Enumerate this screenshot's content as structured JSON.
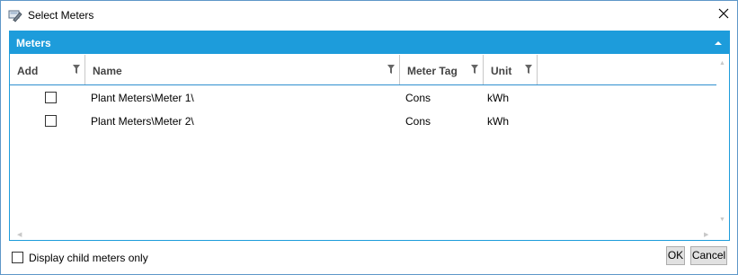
{
  "window": {
    "title": "Select Meters",
    "icon": "meter-select-icon",
    "close_icon": "close-icon"
  },
  "panel": {
    "title": "Meters",
    "collapse_icon": "chevron-up-icon",
    "header_color": "#1d9cdb"
  },
  "grid": {
    "columns": [
      {
        "label": "Add"
      },
      {
        "label": "Name"
      },
      {
        "label": "Meter Tag"
      },
      {
        "label": "Unit"
      }
    ],
    "rows": [
      {
        "checked": false,
        "name": "Plant Meters\\Meter 1\\",
        "tag": "Cons",
        "unit": "kWh"
      },
      {
        "checked": false,
        "name": "Plant Meters\\Meter 2\\",
        "tag": "Cons",
        "unit": "kWh"
      }
    ]
  },
  "footer": {
    "child_only_label": "Display child meters only",
    "child_only_checked": false,
    "ok_label": "OK",
    "cancel_label": "Cancel"
  }
}
